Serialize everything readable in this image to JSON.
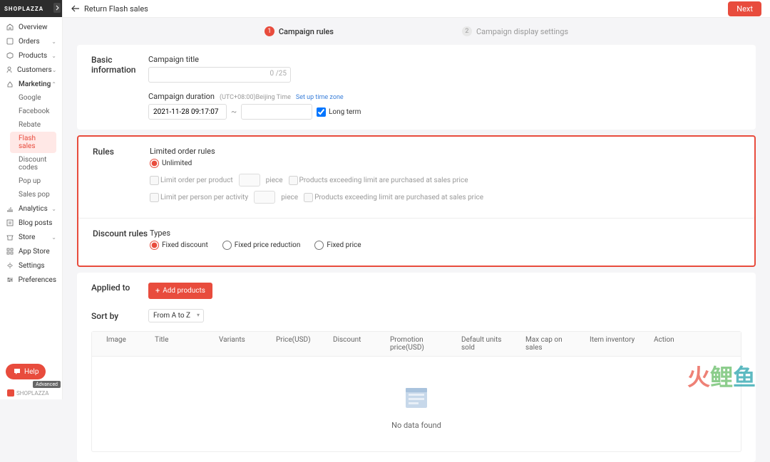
{
  "brand": "SHOPLAZZA",
  "topbar": {
    "back": "Return Flash sales",
    "next": "Next"
  },
  "nav": {
    "overview": "Overview",
    "orders": "Orders",
    "products": "Products",
    "customers": "Customers",
    "marketing": "Marketing",
    "google": "Google",
    "facebook": "Facebook",
    "rebate": "Rebate",
    "flash_sales": "Flash sales",
    "discount_codes": "Discount codes",
    "pop_up": "Pop up",
    "sales_pop": "Sales pop",
    "analytics": "Analytics",
    "blog_posts": "Blog posts",
    "store": "Store",
    "app_store": "App Store",
    "settings": "Settings",
    "preferences": "Preferences"
  },
  "help": "Help",
  "advanced": "Advanced",
  "footer_brand": "SHOPLAZZA",
  "steps": {
    "s1": "Campaign rules",
    "s2": "Campaign display settings"
  },
  "basic": {
    "title": "Basic information",
    "campaign_title_label": "Campaign title",
    "counter": "0 /25",
    "duration_label": "Campaign duration",
    "tz": "(UTC+08:00)Beijing Time",
    "tz_link": "Set up time zone",
    "start_date": "2021-11-28 09:17:07",
    "long_term": "Long term"
  },
  "rules": {
    "title": "Rules",
    "limited_label": "Limited order rules",
    "unlimited": "Unlimited",
    "limit_order": "Limit order per product",
    "piece": "piece",
    "exceed1": "Products exceeding limit are purchased at sales price",
    "limit_person": "Limit per person per activity",
    "exceed2": "Products exceeding limit are purchased at sales price"
  },
  "discount": {
    "title": "Discount rules",
    "types_label": "Types",
    "fixed_discount": "Fixed discount",
    "fixed_reduction": "Fixed price reduction",
    "fixed_price": "Fixed price"
  },
  "applied": {
    "title": "Applied to",
    "add": "Add products",
    "sort_title": "Sort by",
    "sort_value": "From A to Z"
  },
  "table": {
    "image": "Image",
    "title": "Title",
    "variants": "Variants",
    "price": "Price(USD)",
    "discount": "Discount",
    "promo": "Promotion price(USD)",
    "default_sold": "Default units sold",
    "max_cap": "Max cap on sales",
    "inventory": "Item inventory",
    "action": "Action"
  },
  "empty": "No data found",
  "watermark": {
    "a": "火",
    "b": "鲤",
    "c": "鱼"
  }
}
